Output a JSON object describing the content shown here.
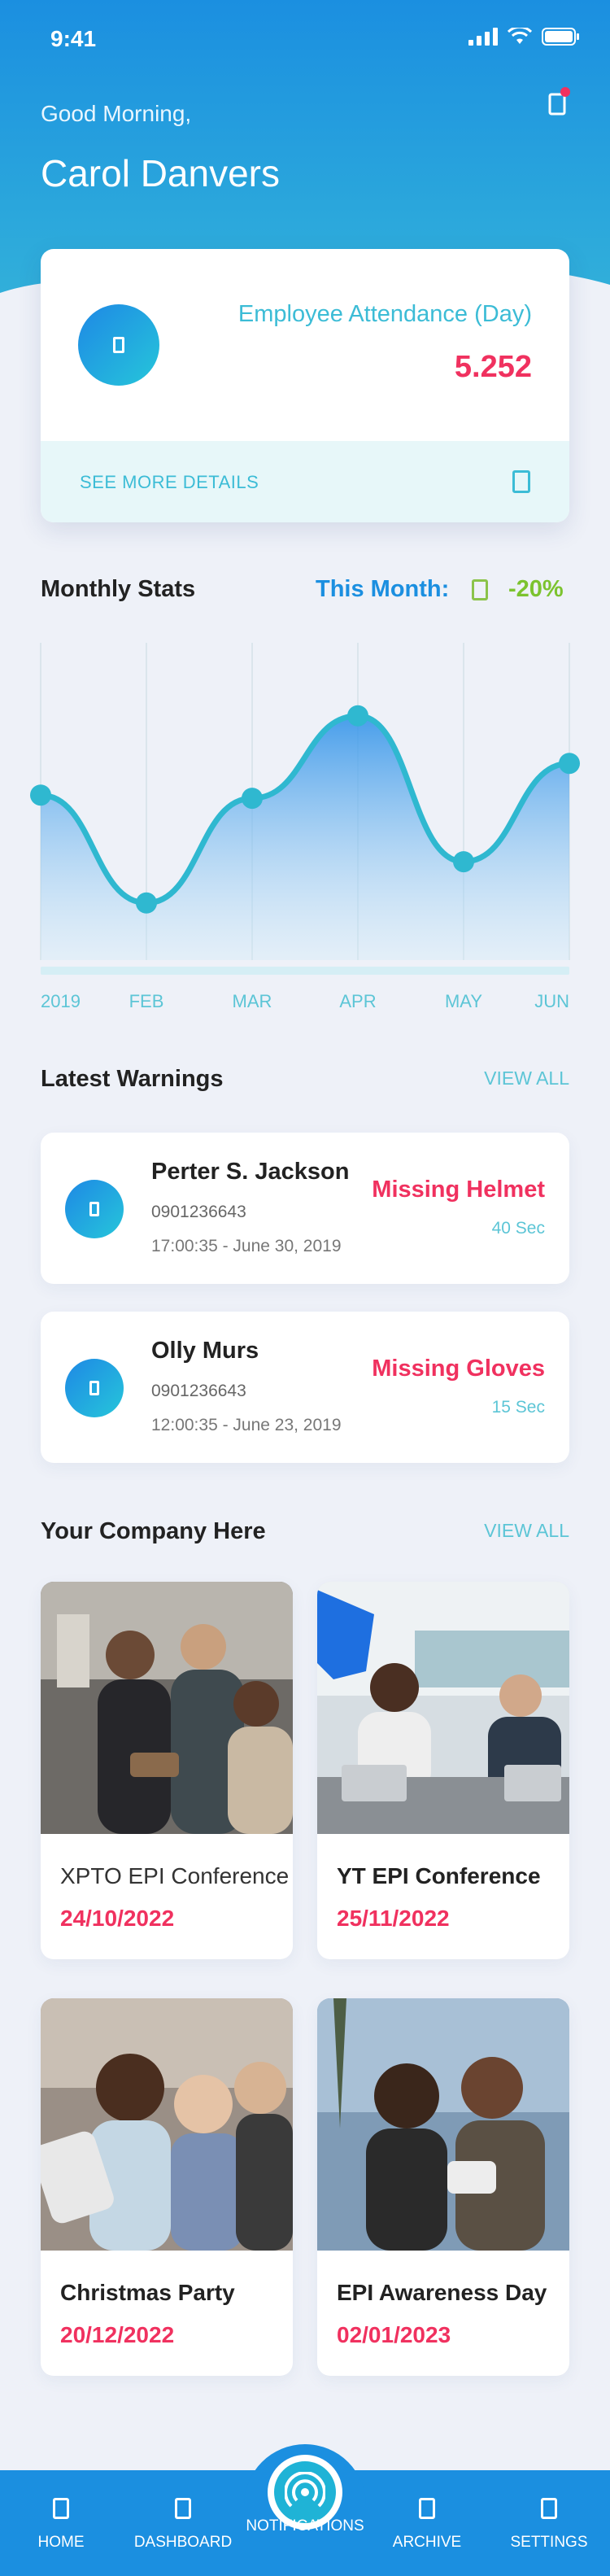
{
  "status_bar": {
    "time": "9:41"
  },
  "header": {
    "greeting": "Good Morning,",
    "user_name": "Carol Danvers"
  },
  "attendance": {
    "title": "Employee Attendance (Day)",
    "value": "5.252",
    "link_label": "SEE MORE DETAILS"
  },
  "stats": {
    "title": "Monthly Stats",
    "period_label": "This Month:",
    "trend_value": "-20%",
    "trend_color": "#7cc32f"
  },
  "chart_data": {
    "type": "area",
    "categories": [
      "2019",
      "FEB",
      "MAR",
      "APR",
      "MAY",
      "JUN"
    ],
    "values": [
      52,
      18,
      51,
      77,
      31,
      62
    ],
    "ylim": [
      0,
      100
    ],
    "grid": true,
    "color": "#2fb8d0"
  },
  "warnings": {
    "title": "Latest Warnings",
    "view_all": "VIEW ALL",
    "items": [
      {
        "name": "Perter S. Jackson",
        "phone": "0901236643",
        "datetime": "17:00:35 - June 30, 2019",
        "type": "Missing Helmet",
        "ago": "40 Sec"
      },
      {
        "name": "Olly Murs",
        "phone": "0901236643",
        "datetime": "12:00:35 - June 23, 2019",
        "type": "Missing Gloves",
        "ago": "15 Sec"
      }
    ]
  },
  "company": {
    "title": "Your Company Here",
    "view_all": "VIEW ALL",
    "events": [
      {
        "title": "XPTO EPI Conference",
        "date": "24/10/2022"
      },
      {
        "title": "YT EPI Conference",
        "date": "25/11/2022"
      },
      {
        "title": "Christmas Party",
        "date": "20/12/2022"
      },
      {
        "title": "EPI Awareness Day",
        "date": "02/01/2023"
      }
    ]
  },
  "tabbar": {
    "home": "HOME",
    "dashboard": "DASHBOARD",
    "notifications": "NOTIFICATIONS",
    "archive": "ARCHIVE",
    "settings": "SETTINGS"
  },
  "colors": {
    "primary": "#1b8fe0",
    "accent": "#f0315f",
    "teal": "#3cbcd6"
  }
}
